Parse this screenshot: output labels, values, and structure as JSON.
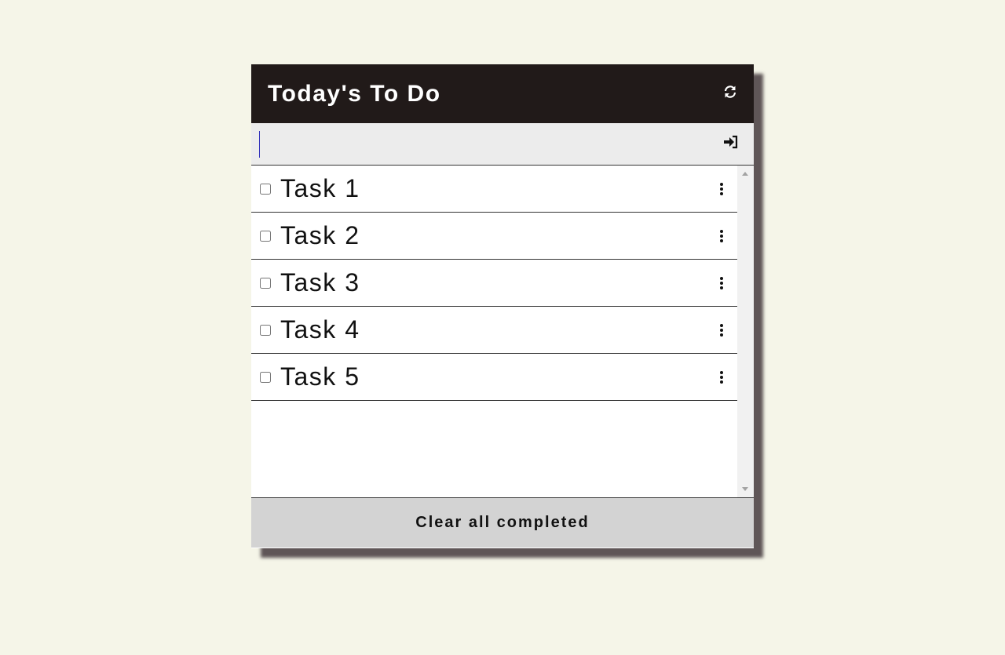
{
  "header": {
    "title": "Today's To Do",
    "refresh_icon": "refresh-icon"
  },
  "input": {
    "value": "",
    "placeholder": "",
    "submit_icon": "sign-in-icon"
  },
  "tasks": [
    {
      "label": "Task 1",
      "checked": false
    },
    {
      "label": "Task 2",
      "checked": false
    },
    {
      "label": "Task 3",
      "checked": false
    },
    {
      "label": "Task 4",
      "checked": false
    },
    {
      "label": "Task 5",
      "checked": false
    }
  ],
  "footer": {
    "clear_label": "Clear all completed"
  },
  "colors": {
    "page_background": "#f5f5e8",
    "header_background": "#211a19",
    "input_background": "#ececec",
    "footer_background": "#d3d3d3",
    "shadow": "#5f5657"
  }
}
